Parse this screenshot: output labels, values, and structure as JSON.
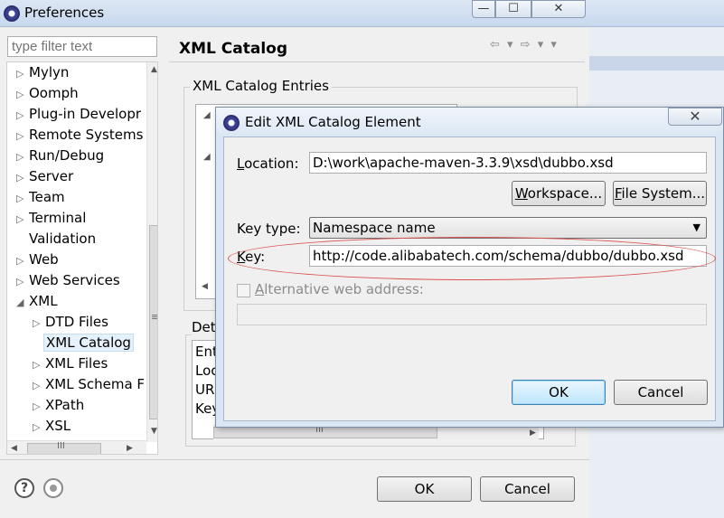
{
  "window": {
    "title": "Preferences",
    "min_glyph": "—",
    "max_glyph": "☐",
    "close_glyph": "✕"
  },
  "filter": {
    "placeholder": "type filter text"
  },
  "tree": {
    "items": [
      {
        "label": "Mylyn",
        "arrow": "▷"
      },
      {
        "label": "Oomph",
        "arrow": "▷"
      },
      {
        "label": "Plug-in Developr",
        "arrow": "▷"
      },
      {
        "label": "Remote Systems",
        "arrow": "▷"
      },
      {
        "label": "Run/Debug",
        "arrow": "▷"
      },
      {
        "label": "Server",
        "arrow": "▷"
      },
      {
        "label": "Team",
        "arrow": "▷"
      },
      {
        "label": "Terminal",
        "arrow": "▷"
      },
      {
        "label": "Validation",
        "arrow": ""
      },
      {
        "label": "Web",
        "arrow": "▷"
      },
      {
        "label": "Web Services",
        "arrow": "▷"
      },
      {
        "label": "XML",
        "arrow": "◢"
      },
      {
        "label": "DTD Files",
        "arrow": "▷"
      },
      {
        "label": "XML Catalog",
        "arrow": ""
      },
      {
        "label": "XML Files",
        "arrow": "▷"
      },
      {
        "label": "XML Schema F",
        "arrow": "▷"
      },
      {
        "label": "XPath",
        "arrow": "▷"
      },
      {
        "label": "XSL",
        "arrow": "▷"
      }
    ],
    "hscroll_grip": "III",
    "vscroll_grip": "≡"
  },
  "page": {
    "title": "XML Catalog",
    "nav_icons": "⇦ ▾ ⇨ ▾ ▾",
    "entries_group": "XML Catalog Entries",
    "details_group": "Det",
    "details_rows": [
      "Ent",
      "Loc",
      "URI",
      "Key"
    ]
  },
  "bottom": {
    "help_glyph": "?",
    "ok": "OK",
    "cancel": "Cancel"
  },
  "dialog": {
    "title": "Edit XML Catalog Element",
    "close_glyph": "✕",
    "location_label_prefix": "L",
    "location_label_rest": "ocation:",
    "location_value": "D:\\work\\apache-maven-3.3.9\\xsd\\dubbo.xsd",
    "workspace_button_prefix": "W",
    "workspace_button_rest": "orkspace...",
    "filesystem_button_prefix": "F",
    "filesystem_button_rest": "ile System...",
    "key_type_label": "Key type:",
    "key_type_value": "Namespace name",
    "key_label_prefix": "K",
    "key_label_rest": "ey:",
    "key_value": "http://code.alibabatech.com/schema/dubbo/dubbo.xsd",
    "alt_prefix": "A",
    "alt_rest": "lternative web address:",
    "alt_value": "",
    "ok": "OK",
    "cancel": "Cancel"
  }
}
